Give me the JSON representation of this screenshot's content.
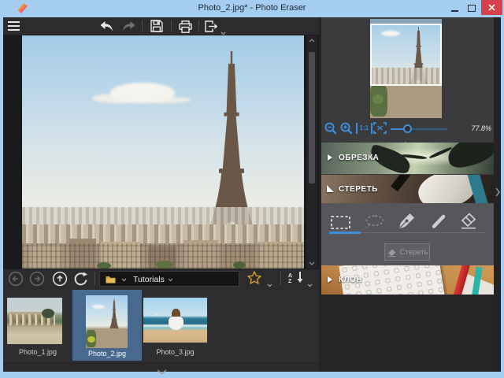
{
  "window": {
    "title": "Photo_2.jpg* - Photo Eraser"
  },
  "toolbar": {
    "icons": [
      "hamburger-menu",
      "undo",
      "redo",
      "save",
      "print",
      "export"
    ]
  },
  "navigator": {
    "zoom_percent": "77.8%",
    "one_to_one_label": "1:1"
  },
  "panels": {
    "crop": {
      "label": "ОБРЕЗКА",
      "state": "collapsed"
    },
    "erase": {
      "label": "СТЕРЕТЬ",
      "state": "expanded",
      "tools": [
        "rect-select",
        "lasso-select",
        "pen-select",
        "stroke-erase",
        "eraser"
      ],
      "active_tool": "rect-select",
      "apply_label": "Стереть"
    },
    "clone": {
      "label": "КЛОН",
      "state": "collapsed"
    }
  },
  "browser": {
    "location": "Tutorials",
    "sort_letters": {
      "a": "A",
      "z": "Z"
    }
  },
  "filmstrip": {
    "items": [
      {
        "name": "Photo_1.jpg",
        "selected": false
      },
      {
        "name": "Photo_2.jpg",
        "selected": true
      },
      {
        "name": "Photo_3.jpg",
        "selected": false
      }
    ]
  },
  "colors": {
    "accent": "#3e8ed9",
    "titlebar": "#a5cdef",
    "selection": "#47698e",
    "close_button": "#d6414d",
    "star": "#d9a31d",
    "panel_bg": "#3b3b3e"
  }
}
